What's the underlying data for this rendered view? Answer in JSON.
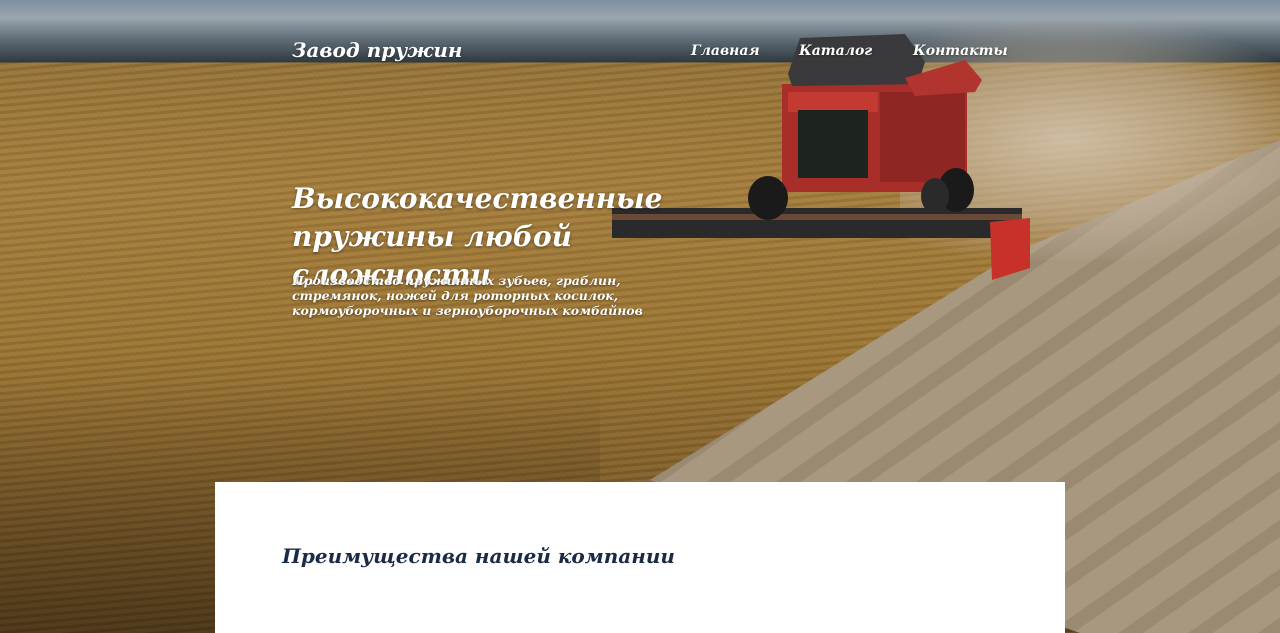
{
  "header": {
    "site_title": "Завод пружин",
    "nav": [
      {
        "label": "Главная"
      },
      {
        "label": "Каталог"
      },
      {
        "label": "Контакты"
      }
    ]
  },
  "hero": {
    "headline_line1": "Высококачественные",
    "headline_line2": "пружины любой сложности",
    "description": "Производство пружинных зубьев, граблин, стремянок, ножей для роторных косилок, кормоуборочных и зерноуборочных комбайнов",
    "background_image": "combine-harvester-field-photo"
  },
  "advantages": {
    "title": "Преимущества нашей компании"
  },
  "colors": {
    "header_text": "#ffffff",
    "card_background": "#ffffff",
    "card_title": "#1c2b45"
  }
}
